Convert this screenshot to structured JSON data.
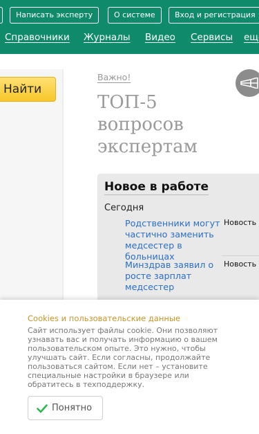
{
  "header": {
    "buttons": [
      "Написать эксперту",
      "О системе",
      "Вход и регистрация"
    ],
    "nav": [
      "Справочники",
      "Журналы",
      "Видео",
      "Сервисы",
      "ещё"
    ]
  },
  "search": {
    "button_label": "Найти"
  },
  "main": {
    "important_link": "Важно!",
    "top5_title": "ТОП-5 вопросов экспертам"
  },
  "news": {
    "title": "Новое в работе",
    "date_label": "Сегодня",
    "items": [
      {
        "title": "Родственники могут частично заменить медсестер в больницах",
        "tag": "Новость"
      },
      {
        "title": "Минздрав заявил о росте зарплат медсестер",
        "tag": "Новость"
      }
    ]
  },
  "cookie": {
    "title": "Cookies и пользовательские данные",
    "text": "Сайт использует файлы cookie. Они позволяют узнавать вас и получать информацию о вашем пользовательском опыте. Это нужно, чтобы улучшать сайт. Если согласны, продолжайте пользоваться сайтом. Если нет – установите специальные настройки в браузере или обратитесь в техподдержку.",
    "button_label": "Понятно"
  },
  "colors": {
    "header_green": "#0f8a6b",
    "find_button_yellow": "#f7c62a",
    "link_blue": "#2a6ec6",
    "cookie_title": "#c8952a",
    "check_green": "#2db84c"
  },
  "icons": [
    "horn-icon",
    "check-icon"
  ]
}
